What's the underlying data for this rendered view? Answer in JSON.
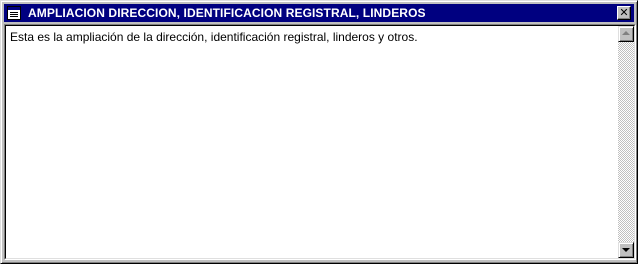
{
  "window": {
    "title": "AMPLIACION DIRECCION, IDENTIFICACION REGISTRAL, LINDEROS",
    "icon": "notepad-icon",
    "close_glyph": "✕"
  },
  "content": {
    "text": "Esta es la ampliación de la dirección, identificación registral, linderos y otros."
  },
  "scrollbar": {
    "up_icon": "scroll-up-arrow-icon",
    "down_icon": "scroll-down-arrow-icon"
  },
  "colors": {
    "titlebar": "#000080",
    "title_text": "#ffffff",
    "face": "#c0c0c0",
    "text_bg": "#ffffff"
  }
}
